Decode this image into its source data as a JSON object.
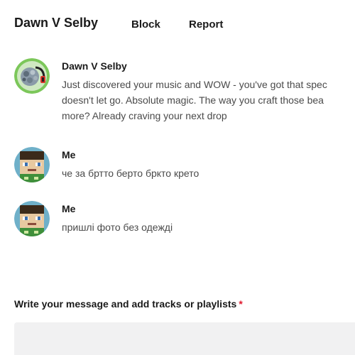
{
  "header": {
    "title": "Dawn V Selby",
    "block_label": "Block",
    "report_label": "Report"
  },
  "messages": [
    {
      "author": "Dawn V Selby",
      "text": "Just discovered your music and WOW - you've got that spec\ndoesn't let go. Absolute magic. The way you craft those bea\nmore? Already craving your next drop",
      "avatar": "headphones-avatar"
    },
    {
      "author": "Me",
      "text": "че за бртто берто бркто крето",
      "avatar": "pixel-character-avatar"
    },
    {
      "author": "Me",
      "text": "пришлі фото без одежді",
      "avatar": "pixel-character-avatar"
    }
  ],
  "compose": {
    "label": "Write your message and add tracks or playlists",
    "required_mark": "*"
  },
  "colors": {
    "text": "#1a1a1a",
    "muted_text": "#4a4a4a",
    "required": "#e0192e",
    "input_bg": "#f1f1f2",
    "avatar_ring": "#7cc75a"
  }
}
